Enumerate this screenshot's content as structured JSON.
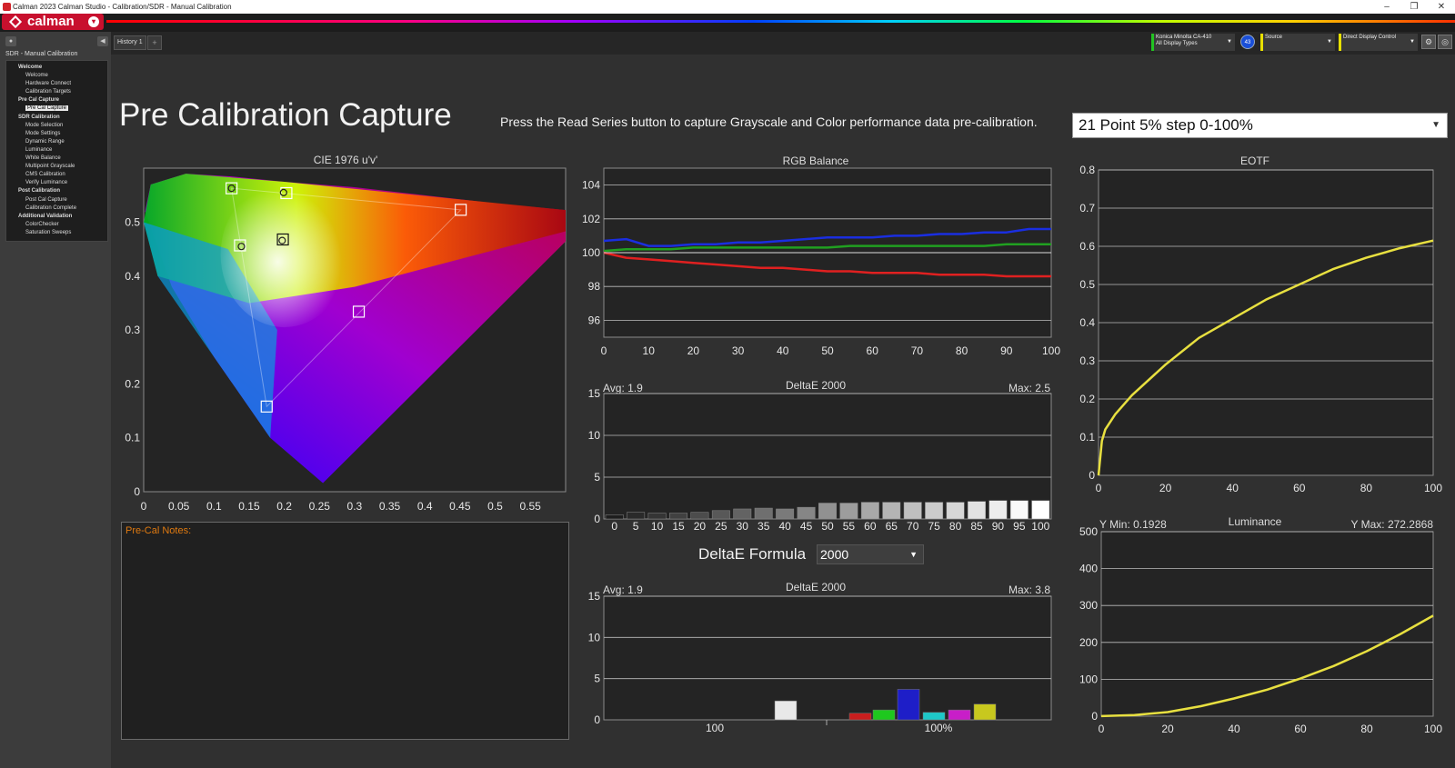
{
  "window": {
    "title": "Calman 2023 Calman Studio  - Calibration/SDR - Manual Calibration",
    "minimize": "–",
    "restore": "❐",
    "close": "✕"
  },
  "logo": {
    "text": "calman"
  },
  "history_tab": {
    "label": "History 1",
    "add": "+"
  },
  "devices": {
    "meter_line1": "Konica Minolta CA-410",
    "meter_line2": "All Display Types",
    "meter_badge": "43",
    "source": "Source",
    "display": "Direct Display Control"
  },
  "colors": {
    "meter": "#22c322",
    "source": "#e8e000",
    "display": "#e8e000",
    "accent": "#c8102e",
    "notes_label": "#e07a10"
  },
  "sidebar": {
    "title": "SDR - Manual Calibration",
    "items": [
      {
        "label": "Welcome",
        "level": "sec"
      },
      {
        "label": "Welcome",
        "level": "sub"
      },
      {
        "label": "Hardware Connect",
        "level": "sub"
      },
      {
        "label": "Calibration Targets",
        "level": "sub"
      },
      {
        "label": "Pre Cal Capture",
        "level": "sec"
      },
      {
        "label": "Pre Cal Capture",
        "level": "sub",
        "active": true
      },
      {
        "label": "SDR Calibration",
        "level": "sec"
      },
      {
        "label": "Mode Selection",
        "level": "sub"
      },
      {
        "label": "Mode Settings",
        "level": "sub"
      },
      {
        "label": "Dynamic Range",
        "level": "sub"
      },
      {
        "label": "Luminance",
        "level": "sub"
      },
      {
        "label": "White Balance",
        "level": "sub"
      },
      {
        "label": "Multipoint Grayscale",
        "level": "sub"
      },
      {
        "label": "CMS Calibration",
        "level": "sub"
      },
      {
        "label": "Verify Luminance",
        "level": "sub"
      },
      {
        "label": "Post Calibration",
        "level": "sec"
      },
      {
        "label": "Post Cal Capture",
        "level": "sub"
      },
      {
        "label": "Calibration Complete",
        "level": "sub"
      },
      {
        "label": "Additional Validation",
        "level": "sec"
      },
      {
        "label": "ColorChecker",
        "level": "sub"
      },
      {
        "label": "Saturation Sweeps",
        "level": "sub"
      }
    ]
  },
  "page": {
    "title": "Pre Calibration Capture",
    "instruction": "Press the Read Series button to capture Grayscale and Color performance data pre-calibration.",
    "series_select": "21 Point 5% step 0-100%",
    "notes_label": "Pre-Cal Notes:",
    "formula_label": "DeltaE Formula",
    "formula_value": "2000"
  },
  "chart_data": [
    {
      "id": "cie",
      "type": "scatter",
      "title": "CIE 1976 u'v'",
      "xticks": [
        "0",
        "0.05",
        "0.1",
        "0.15",
        "0.2",
        "0.25",
        "0.3",
        "0.35",
        "0.4",
        "0.45",
        "0.5",
        "0.55"
      ],
      "yticks": [
        "0",
        "0.1",
        "0.2",
        "0.3",
        "0.4",
        "0.5"
      ],
      "xlim": [
        0,
        0.6
      ],
      "ylim": [
        0,
        0.6
      ],
      "targets": [
        {
          "name": "Red",
          "u": 0.451,
          "v": 0.523
        },
        {
          "name": "Green",
          "u": 0.125,
          "v": 0.563
        },
        {
          "name": "Blue",
          "u": 0.175,
          "v": 0.158
        },
        {
          "name": "Cyan",
          "u": 0.137,
          "v": 0.457
        },
        {
          "name": "Magenta",
          "u": 0.306,
          "v": 0.334
        },
        {
          "name": "Yellow",
          "u": 0.203,
          "v": 0.554
        },
        {
          "name": "White",
          "u": 0.198,
          "v": 0.468
        }
      ],
      "measured": [
        {
          "u": 0.125,
          "v": 0.563
        },
        {
          "u": 0.199,
          "v": 0.555
        },
        {
          "u": 0.139,
          "v": 0.455
        },
        {
          "u": 0.197,
          "v": 0.466
        }
      ]
    },
    {
      "id": "rgb",
      "type": "line",
      "title": "RGB Balance",
      "xticks": [
        "0",
        "10",
        "20",
        "30",
        "40",
        "50",
        "60",
        "70",
        "80",
        "90",
        "100"
      ],
      "yticks": [
        "96",
        "98",
        "100",
        "102",
        "104"
      ],
      "xlim": [
        0,
        100
      ],
      "ylim": [
        95,
        105
      ],
      "x": [
        0,
        5,
        10,
        15,
        20,
        25,
        30,
        35,
        40,
        45,
        50,
        55,
        60,
        65,
        70,
        75,
        80,
        85,
        90,
        95,
        100
      ],
      "series": [
        {
          "color": "#1a2ee0",
          "values": [
            100.7,
            100.8,
            100.4,
            100.4,
            100.5,
            100.5,
            100.6,
            100.6,
            100.7,
            100.8,
            100.9,
            100.9,
            100.9,
            101.0,
            101.0,
            101.1,
            101.1,
            101.2,
            101.2,
            101.4,
            101.4
          ]
        },
        {
          "color": "#20a020",
          "values": [
            100.1,
            100.2,
            100.2,
            100.2,
            100.3,
            100.3,
            100.3,
            100.3,
            100.3,
            100.3,
            100.3,
            100.4,
            100.4,
            100.4,
            100.4,
            100.4,
            100.4,
            100.4,
            100.5,
            100.5,
            100.5
          ]
        },
        {
          "color": "#e02020",
          "values": [
            100.0,
            99.7,
            99.6,
            99.5,
            99.4,
            99.3,
            99.2,
            99.1,
            99.1,
            99.0,
            98.9,
            98.9,
            98.8,
            98.8,
            98.8,
            98.7,
            98.7,
            98.7,
            98.6,
            98.6,
            98.6
          ]
        }
      ],
      "reference": 100
    },
    {
      "id": "de_gray",
      "type": "bar",
      "title": "DeltaE 2000",
      "avg_label": "Avg: 1.9",
      "max_label": "Max: 2.5",
      "categories": [
        "0",
        "5",
        "10",
        "15",
        "20",
        "25",
        "30",
        "35",
        "40",
        "45",
        "50",
        "55",
        "60",
        "65",
        "70",
        "75",
        "80",
        "85",
        "90",
        "95",
        "100"
      ],
      "values": [
        0.5,
        0.8,
        0.7,
        0.7,
        0.8,
        1.0,
        1.2,
        1.3,
        1.2,
        1.4,
        1.9,
        1.9,
        2.0,
        2.0,
        2.0,
        2.0,
        2.0,
        2.1,
        2.2,
        2.2,
        2.2
      ],
      "yticks": [
        "0",
        "5",
        "10",
        "15"
      ],
      "ylim": [
        0,
        15
      ]
    },
    {
      "id": "de_color",
      "type": "bar",
      "title": "DeltaE 2000",
      "avg_label": "Avg: 1.9",
      "max_label": "Max: 3.8",
      "categories": [
        "100",
        "100%"
      ],
      "bars": [
        {
          "color": "#e8e8e8",
          "value": 2.3
        },
        {
          "color": "#c81e1e",
          "value": 0.8
        },
        {
          "color": "#1ec81e",
          "value": 1.2
        },
        {
          "color": "#1e1ec8",
          "value": 3.7
        },
        {
          "color": "#1ec8c8",
          "value": 0.9
        },
        {
          "color": "#c81ec8",
          "value": 1.2
        },
        {
          "color": "#c8c81e",
          "value": 1.9
        }
      ],
      "yticks": [
        "0",
        "5",
        "10",
        "15"
      ],
      "ylim": [
        0,
        15
      ]
    },
    {
      "id": "eotf",
      "type": "line",
      "title": "EOTF",
      "xticks": [
        "0",
        "20",
        "40",
        "60",
        "80",
        "100"
      ],
      "yticks": [
        "0",
        "0.1",
        "0.2",
        "0.3",
        "0.4",
        "0.5",
        "0.6",
        "0.7",
        "0.8"
      ],
      "xlim": [
        0,
        100
      ],
      "ylim": [
        0,
        0.8
      ],
      "x": [
        0,
        1,
        2,
        5,
        10,
        20,
        30,
        40,
        50,
        60,
        70,
        80,
        90,
        100
      ],
      "series": [
        {
          "color": "#e8e040",
          "values": [
            0,
            0.09,
            0.12,
            0.16,
            0.21,
            0.29,
            0.36,
            0.41,
            0.46,
            0.5,
            0.54,
            0.57,
            0.595,
            0.615
          ]
        }
      ]
    },
    {
      "id": "luminance",
      "type": "line",
      "title": "Luminance",
      "min_label": "Y Min: 0.1928",
      "max_label": "Y Max: 272.2868",
      "xticks": [
        "0",
        "20",
        "40",
        "60",
        "80",
        "100"
      ],
      "yticks": [
        "0",
        "100",
        "200",
        "300",
        "400",
        "500"
      ],
      "xlim": [
        0,
        100
      ],
      "ylim": [
        0,
        500
      ],
      "x": [
        0,
        10,
        20,
        30,
        40,
        50,
        60,
        70,
        80,
        90,
        100
      ],
      "series": [
        {
          "color": "#e8e040",
          "values": [
            0.19,
            3,
            11,
            27,
            48,
            72,
            102,
            136,
            176,
            222,
            272.3
          ]
        }
      ]
    }
  ]
}
